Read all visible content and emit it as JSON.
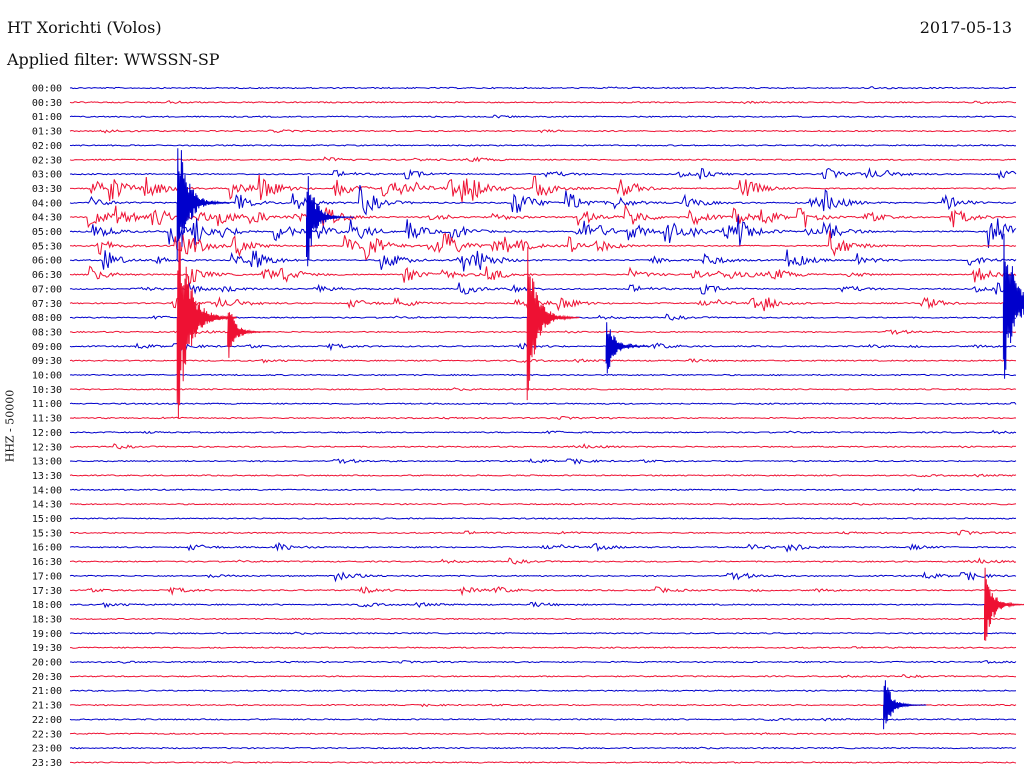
{
  "header": {
    "station": "HT Xorichti (Volos)",
    "filter": "Applied filter: WWSSN-SP",
    "date": "2017-05-13"
  },
  "chart_data": {
    "type": "line",
    "ylabel": "HHZ - 50000",
    "row_labels": [
      "00:00",
      "00:30",
      "01:00",
      "01:30",
      "02:00",
      "02:30",
      "03:00",
      "03:30",
      "04:00",
      "04:30",
      "05:00",
      "05:30",
      "06:00",
      "06:30",
      "07:00",
      "07:30",
      "08:00",
      "08:30",
      "09:00",
      "09:30",
      "10:00",
      "10:30",
      "11:00",
      "11:30",
      "12:00",
      "12:30",
      "13:00",
      "13:30",
      "14:00",
      "14:30",
      "15:00",
      "15:30",
      "16:00",
      "16:30",
      "17:00",
      "17:30",
      "18:00",
      "18:30",
      "19:00",
      "19:30",
      "20:00",
      "20:30",
      "21:00",
      "21:30",
      "22:00",
      "22:30",
      "23:00",
      "23:30"
    ],
    "series_colors": [
      "#0000cc",
      "#ee1133"
    ],
    "activity_levels": [
      0.05,
      0.06,
      0.05,
      0.08,
      0.06,
      0.14,
      0.3,
      0.55,
      0.6,
      0.5,
      0.6,
      0.62,
      0.55,
      0.4,
      0.32,
      0.3,
      0.1,
      0.1,
      0.14,
      0.08,
      0.06,
      0.08,
      0.06,
      0.06,
      0.08,
      0.08,
      0.1,
      0.05,
      0.05,
      0.05,
      0.05,
      0.12,
      0.2,
      0.1,
      0.18,
      0.16,
      0.12,
      0.08,
      0.06,
      0.05,
      0.05,
      0.04,
      0.04,
      0.04,
      0.05,
      0.04,
      0.04,
      0.05
    ],
    "events": [
      {
        "row": 16,
        "minute_offset": 3.4,
        "amplitude": 1.0,
        "color": "#ee1133"
      },
      {
        "row": 16,
        "minute_offset": 14.5,
        "amplitude": 0.7,
        "color": "#ee1133"
      },
      {
        "row": 15,
        "minute_offset": 29.6,
        "amplitude": 0.8,
        "color": "#0000cc"
      },
      {
        "row": 8,
        "minute_offset": 3.4,
        "amplitude": 0.7,
        "color": "#0000cc"
      },
      {
        "row": 9,
        "minute_offset": 7.5,
        "amplitude": 0.5,
        "color": "#0000cc"
      },
      {
        "row": 36,
        "minute_offset": 29.0,
        "amplitude": 0.4,
        "color": "#ee1133"
      },
      {
        "row": 43,
        "minute_offset": 25.8,
        "amplitude": 0.3,
        "color": "#0000cc"
      },
      {
        "row": 17,
        "minute_offset": 5.0,
        "amplitude": 0.3,
        "color": "#ee1133"
      },
      {
        "row": 24,
        "minute_offset": 30.5,
        "amplitude": 0.3,
        "color": "#ee1133"
      },
      {
        "row": 18,
        "minute_offset": 17.0,
        "amplitude": 0.3,
        "color": "#0000cc"
      }
    ]
  }
}
